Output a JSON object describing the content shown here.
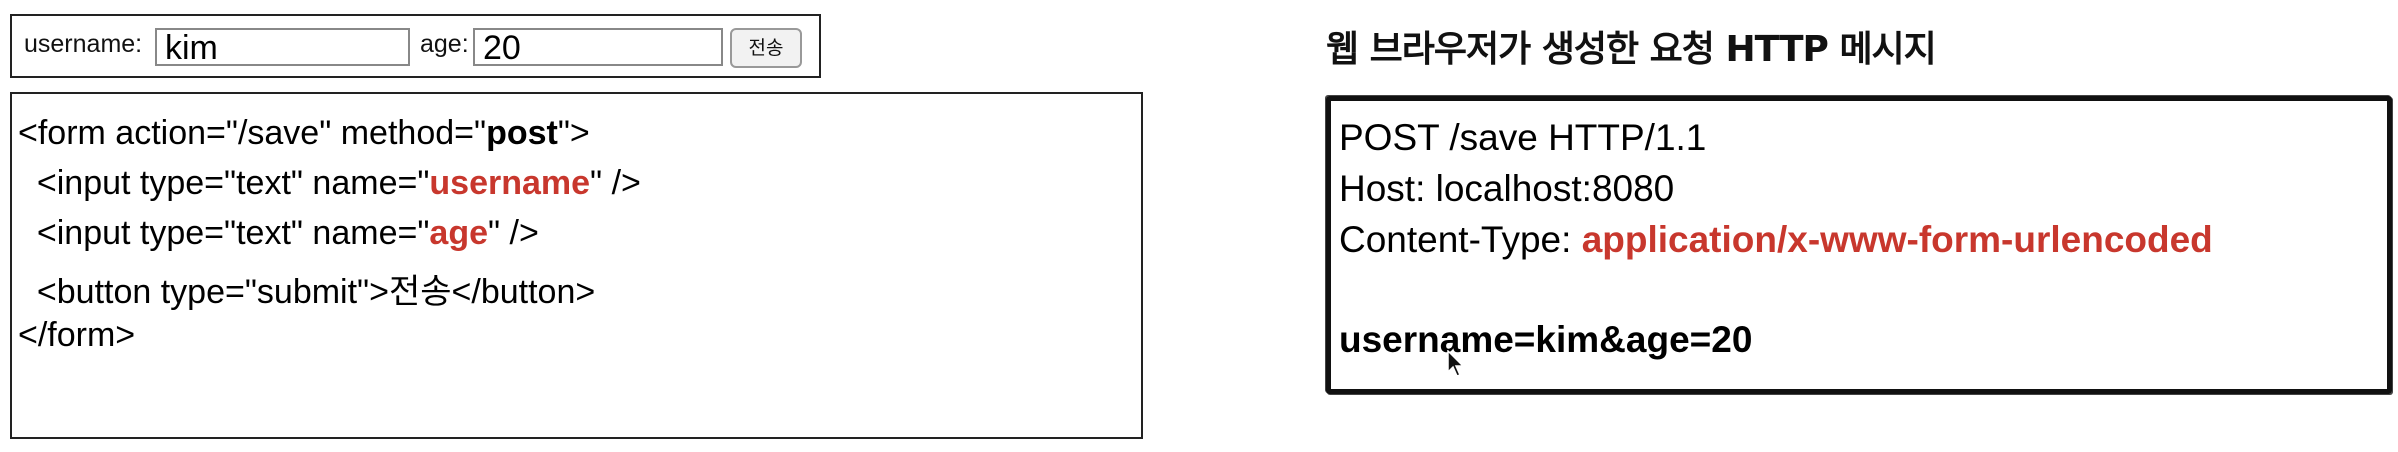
{
  "form": {
    "username_label": "username:",
    "username_value": "kim",
    "age_label": "age:",
    "age_value": "20",
    "submit_label": "전송"
  },
  "code": {
    "line1": {
      "a": "<form action=\"/save\" method=\"",
      "b": "post",
      "c": "\">"
    },
    "line2": {
      "a": "  <input type=\"text\" name=\"",
      "b": "username",
      "c": "\" />"
    },
    "line3": {
      "a": "  <input type=\"text\" name=\"",
      "b": "age",
      "c": "\" />"
    },
    "line4": "  <button type=\"submit\">전송</button>",
    "line5": "</form>"
  },
  "http": {
    "title": "웹 브라우저가 생성한 요청 HTTP 메시지",
    "request_line": "POST /save HTTP/1.1",
    "host_line": "Host: localhost:8080",
    "content_type_label": "Content-Type: ",
    "content_type_value": "application/x-www-form-urlencoded",
    "body": "username=kim&age=20"
  },
  "colors": {
    "accent": "#c8372d"
  },
  "icons": {
    "cursor": "mouse-pointer-icon"
  }
}
